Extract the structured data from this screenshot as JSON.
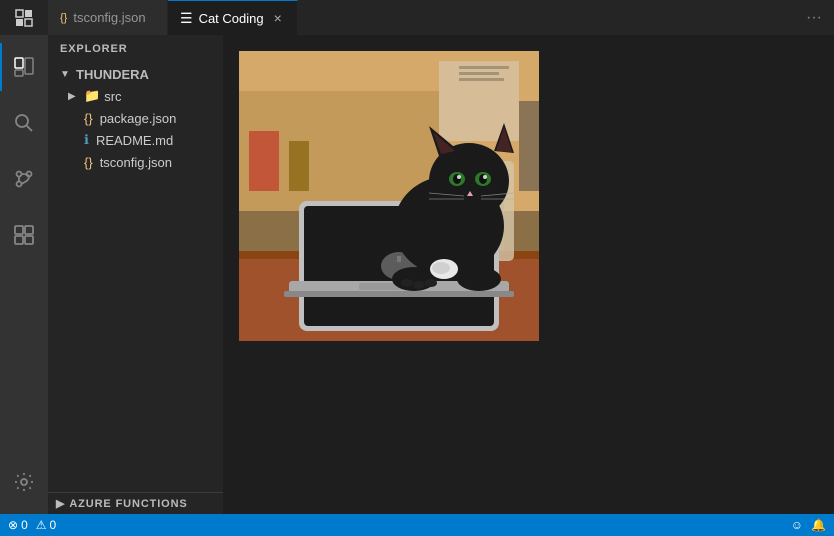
{
  "titlebar": {
    "explorer_label": "EXPLORER",
    "tab_inactive_icon": "{}",
    "tab_inactive_label": "tsconfig.json",
    "tab_active_icon": "≡",
    "tab_active_label": "Cat Coding",
    "tab_close_symbol": "×",
    "more_symbol": "···"
  },
  "activity_bar": {
    "items": [
      {
        "name": "explorer",
        "icon": "⧉",
        "active": true
      },
      {
        "name": "search",
        "icon": "🔍"
      },
      {
        "name": "source-control",
        "icon": "⑂"
      },
      {
        "name": "extensions",
        "icon": "⊟"
      }
    ],
    "bottom_items": [
      {
        "name": "settings",
        "icon": "⚙"
      }
    ]
  },
  "sidebar": {
    "header": "EXPLORER",
    "tree": {
      "root": "THUNDERA",
      "children": [
        {
          "name": "src",
          "type": "folder",
          "expanded": false
        },
        {
          "name": "package.json",
          "type": "json"
        },
        {
          "name": "README.md",
          "type": "md"
        },
        {
          "name": "tsconfig.json",
          "type": "json"
        }
      ]
    },
    "footer": "AZURE FUNCTIONS"
  },
  "status_bar": {
    "errors": "0",
    "warnings": "0",
    "error_icon": "⊗",
    "warning_icon": "⚠",
    "smiley_icon": "☺",
    "bell_icon": "🔔"
  }
}
